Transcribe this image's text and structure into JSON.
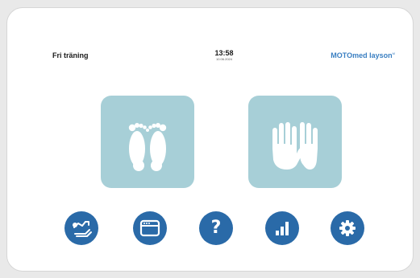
{
  "header": {
    "mode_title": "Fri träning",
    "time": "13:58",
    "date": "10.06.2024",
    "brand": "MOTOmed layson",
    "brand_superscript": "M"
  },
  "tiles": [
    {
      "name": "legs",
      "icon": "feet-icon"
    },
    {
      "name": "arms",
      "icon": "hands-icon"
    }
  ],
  "nav": [
    {
      "name": "program",
      "icon": "therapy-program-icon"
    },
    {
      "name": "menu",
      "icon": "window-menu-icon"
    },
    {
      "name": "help",
      "icon": "question-icon",
      "label": "?"
    },
    {
      "name": "statistics",
      "icon": "bar-chart-icon"
    },
    {
      "name": "settings",
      "icon": "gear-icon"
    }
  ],
  "colors": {
    "tile": "#a7cfd7",
    "nav_button": "#2a6aa8",
    "brand": "#3a7fc2",
    "icon": "#ffffff"
  }
}
